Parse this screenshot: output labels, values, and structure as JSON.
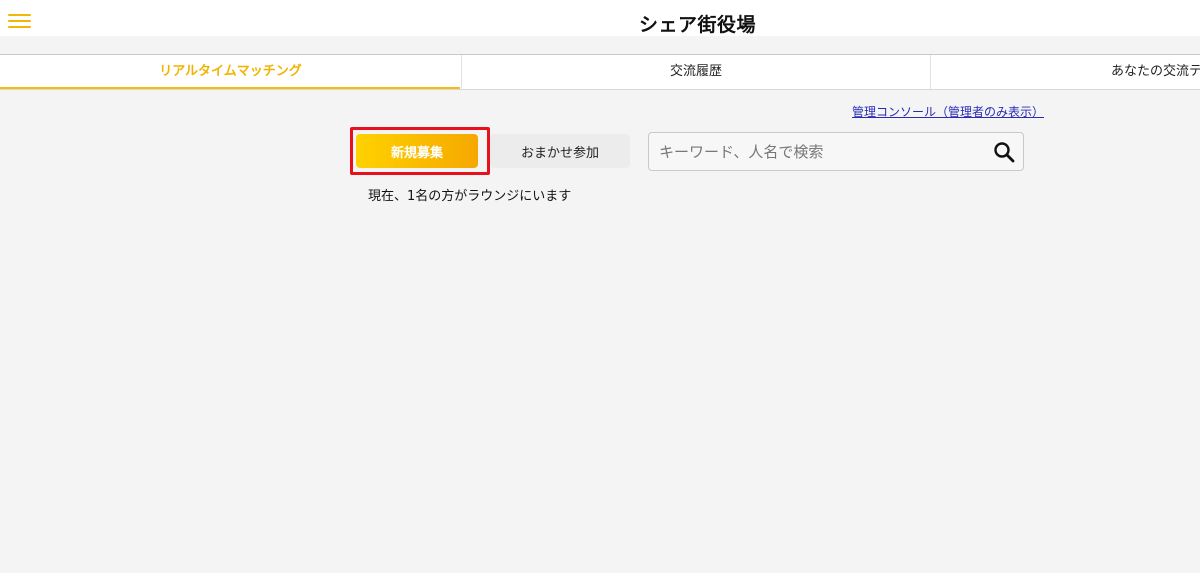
{
  "header": {
    "menu_icon": "hamburger-menu-icon",
    "title": "シェア街役場"
  },
  "tabs": [
    {
      "label": "リアルタイムマッチング",
      "active": true
    },
    {
      "label": "交流履歴",
      "active": false
    },
    {
      "label": "あなたの交流テ",
      "active": false
    }
  ],
  "admin": {
    "link_label": "管理コンソール（管理者のみ表示）"
  },
  "actions": {
    "new_recruit_label": "新規募集",
    "random_join_label": "おまかせ参加"
  },
  "search": {
    "placeholder": "キーワード、人名で検索",
    "value": "",
    "icon": "search-icon"
  },
  "status": {
    "lounge_text": "現在、1名の方がラウンジにいます"
  },
  "colors": {
    "accent": "#f5bd0f",
    "highlight": "#e8101c",
    "link": "#2a2ab8"
  }
}
